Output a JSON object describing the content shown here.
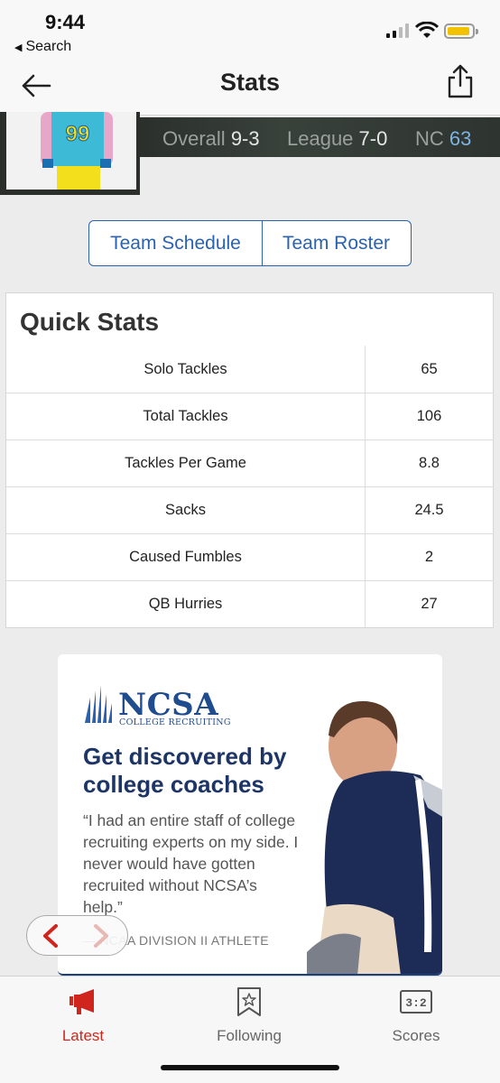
{
  "status_bar": {
    "time": "9:44",
    "back_app_label": "Search"
  },
  "navbar": {
    "title": "Stats"
  },
  "record": {
    "overall_label": "Overall",
    "overall_value": "9-3",
    "league_label": "League",
    "league_value": "7-0",
    "nc_label": "NC",
    "nc_value": "63",
    "jersey_number": "99"
  },
  "buttons": {
    "team_schedule": "Team Schedule",
    "team_roster": "Team Roster"
  },
  "quick_stats": {
    "heading": "Quick Stats",
    "rows": [
      {
        "label": "Solo Tackles",
        "value": "65"
      },
      {
        "label": "Total Tackles",
        "value": "106"
      },
      {
        "label": "Tackles Per Game",
        "value": "8.8"
      },
      {
        "label": "Sacks",
        "value": "24.5"
      },
      {
        "label": "Caused Fumbles",
        "value": "2"
      },
      {
        "label": "QB Hurries",
        "value": "27"
      }
    ]
  },
  "ad": {
    "brand": "NCSA",
    "brand_sub": "COLLEGE RECRUITING",
    "headline": "Get discovered by college coaches",
    "quote": "“I had an entire staff of college recruiting experts on my side. I never would have gotten recruited without NCSA’s help.”",
    "attribution": "— NCAA DIVISION II ATHLETE"
  },
  "tabs": [
    {
      "label": "Latest",
      "icon": "megaphone-icon",
      "active": true
    },
    {
      "label": "Following",
      "icon": "bookmark-star-icon",
      "active": false
    },
    {
      "label": "Scores",
      "icon": "scoreboard-icon",
      "active": false
    }
  ],
  "colors": {
    "accent_blue": "#2a62b0",
    "active_tab_red": "#d0251d",
    "brand_navy": "#1d3566"
  }
}
